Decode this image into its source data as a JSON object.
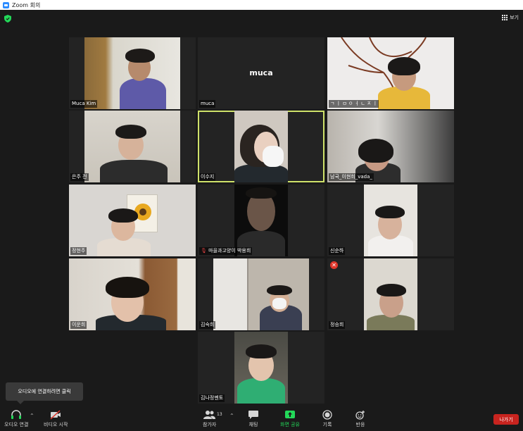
{
  "window": {
    "title": "Zoom 회의"
  },
  "topbar": {
    "view_label": "보기"
  },
  "tiles": [
    {
      "name": "Muca Kim"
    },
    {
      "name": "muca",
      "center_name": "muca"
    },
    {
      "name": "ㄱ ㅣ ㅁ ㅇ ㅓ ㄴ ㅈ ㅣ"
    },
    {
      "name": "은주 전"
    },
    {
      "name": "이수지"
    },
    {
      "name": "남국_이현희_vada_"
    },
    {
      "name": "정현주"
    },
    {
      "name": "마을과고양이 박용희"
    },
    {
      "name": "신순하"
    },
    {
      "name": "이운희"
    },
    {
      "name": "김숙희"
    },
    {
      "name": "정승희"
    },
    {
      "name": "김나정멘토"
    }
  ],
  "tooltip": {
    "text": "오디오에 연결하려면 클릭"
  },
  "toolbar": {
    "audio_label": "오디오 연결",
    "video_label": "비디오 시작",
    "participants_label": "참가자",
    "participants_count": "13",
    "chat_label": "채팅",
    "share_label": "화면 공유",
    "record_label": "기록",
    "reactions_label": "반응",
    "leave_label": "나가기"
  },
  "colors": {
    "accent_green": "#23d959",
    "leave_red": "#c8241f",
    "active_border": "#cfe26a"
  }
}
